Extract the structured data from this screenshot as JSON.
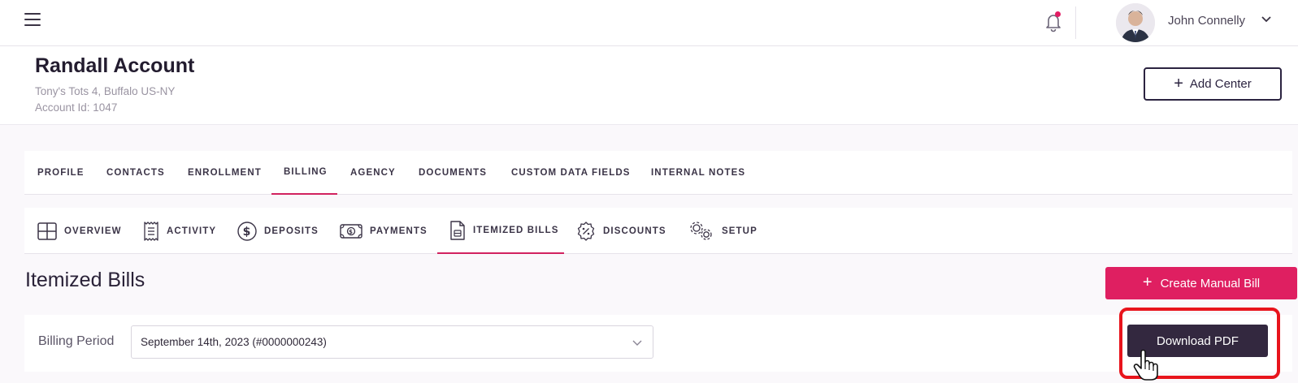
{
  "topbar": {
    "menu_icon": "hamburger-icon",
    "notification_icon": "bell-icon",
    "user": {
      "name": "John Connelly",
      "avatar_icon": "user-avatar",
      "chevron_icon": "chevron-down-icon"
    }
  },
  "account": {
    "title": "Randall Account",
    "subtitle": "Tony's Tots 4, Buffalo US-NY",
    "account_id": "Account Id: 1047",
    "add_center_label": "Add Center"
  },
  "main_tabs": [
    {
      "label": "PROFILE",
      "active": false
    },
    {
      "label": "CONTACTS",
      "active": false
    },
    {
      "label": "ENROLLMENT",
      "active": false
    },
    {
      "label": "BILLING",
      "active": true
    },
    {
      "label": "AGENCY",
      "active": false
    },
    {
      "label": "DOCUMENTS",
      "active": false
    },
    {
      "label": "CUSTOM DATA FIELDS",
      "active": false
    },
    {
      "label": "INTERNAL NOTES",
      "active": false
    }
  ],
  "sub_tabs": [
    {
      "label": "OVERVIEW",
      "icon": "grid-icon",
      "active": false
    },
    {
      "label": "ACTIVITY",
      "icon": "receipt-icon",
      "active": false
    },
    {
      "label": "DEPOSITS",
      "icon": "dollar-circle-icon",
      "active": false
    },
    {
      "label": "PAYMENTS",
      "icon": "cash-icon",
      "active": false
    },
    {
      "label": "ITEMIZED BILLS",
      "icon": "document-icon",
      "active": true
    },
    {
      "label": "DISCOUNTS",
      "icon": "percent-badge-icon",
      "active": false
    },
    {
      "label": "SETUP",
      "icon": "gears-icon",
      "active": false
    }
  ],
  "section": {
    "title": "Itemized Bills",
    "create_button_label": "Create Manual Bill",
    "billing_period_label": "Billing Period",
    "billing_period_value": "September 14th, 2023 (#0000000243)",
    "download_button_label": "Download PDF"
  },
  "colors": {
    "accent": "#df1f61",
    "dark_button": "#33283f",
    "highlight": "#e8141c",
    "text_dark": "#2a2238"
  }
}
